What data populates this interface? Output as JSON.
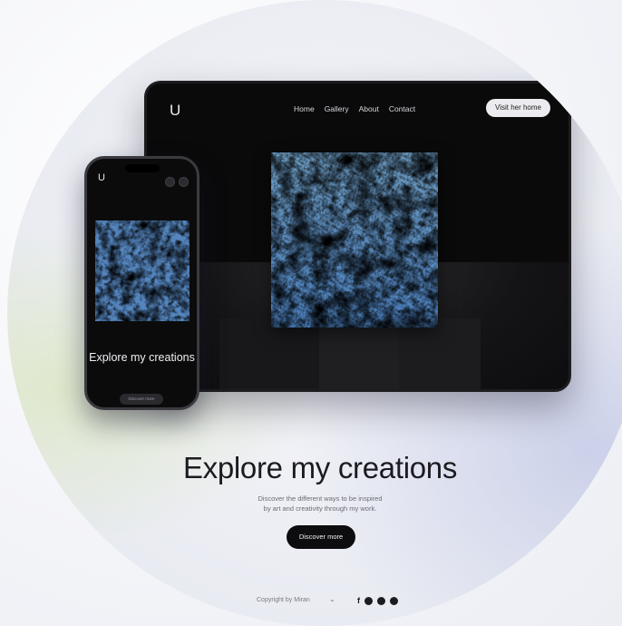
{
  "tablet": {
    "logo": "U",
    "nav": [
      "Home",
      "Gallery",
      "About",
      "Contact"
    ],
    "cta_label": "Visit her home"
  },
  "phone": {
    "logo": "U",
    "title": "Explore my creations",
    "button_label": "Discover more"
  },
  "hero": {
    "title": "Explore my creations",
    "subtitle_line1": "Discover the different ways to be inspired",
    "subtitle_line2": "by art and creativity through my work.",
    "button_label": "Discover more"
  },
  "footer": {
    "language": "Copyright by Miran",
    "social_icons": [
      "facebook-icon",
      "instagram-icon",
      "twitter-icon",
      "linkedin-icon"
    ]
  }
}
